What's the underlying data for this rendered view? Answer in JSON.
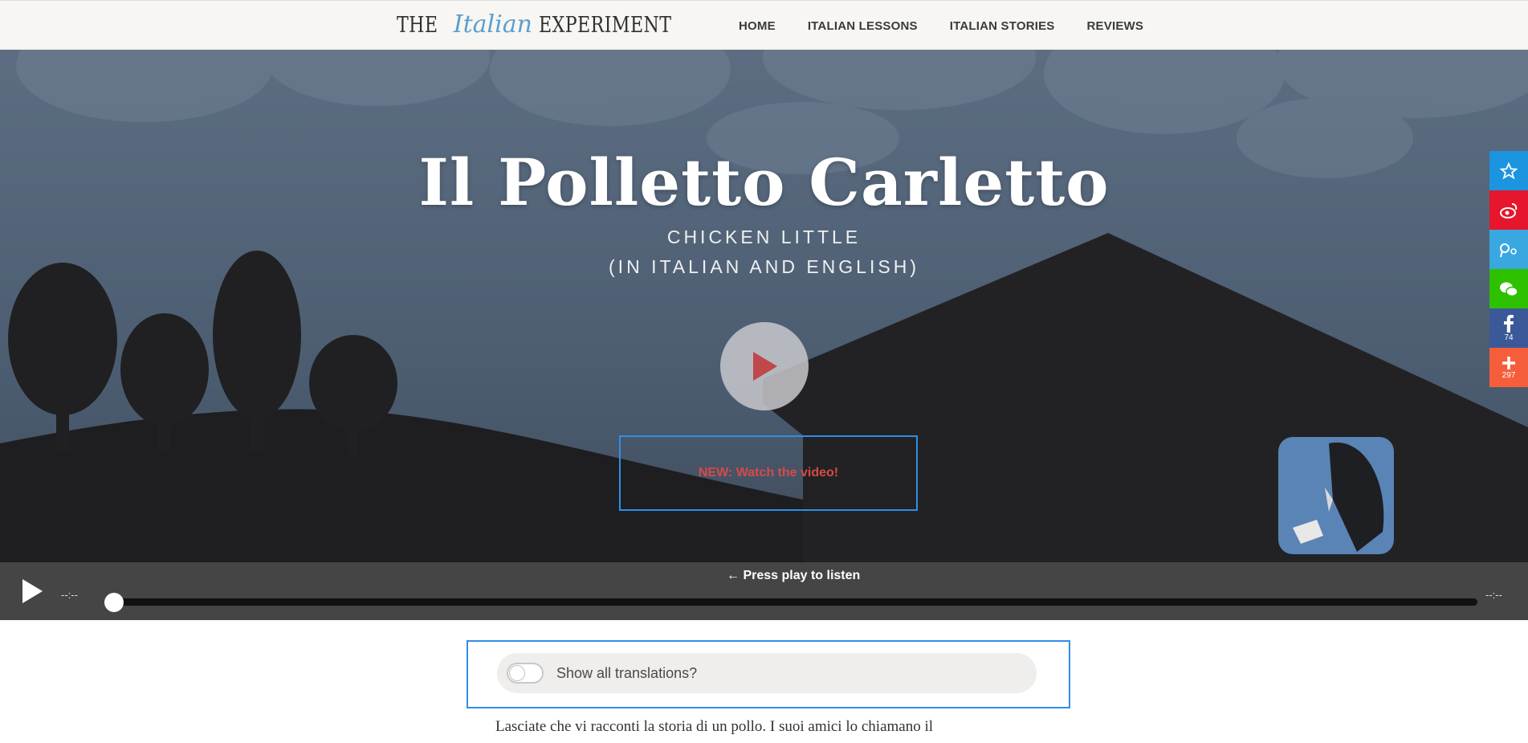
{
  "header": {
    "logo": {
      "the": "THE",
      "italian": "Italian",
      "experiment": "EXPERIMENT"
    },
    "nav": [
      "HOME",
      "ITALIAN LESSONS",
      "ITALIAN STORIES",
      "REVIEWS"
    ]
  },
  "hero": {
    "title": "Il Polletto Carletto",
    "subtitle_1": "CHICKEN LITTLE",
    "subtitle_2": "(IN ITALIAN AND ENGLISH)",
    "video_link": "NEW: Watch the video!"
  },
  "share": {
    "buttons": [
      {
        "icon": "star-icon",
        "color": "#1b95e0"
      },
      {
        "icon": "weibo-icon",
        "color": "#e6162d"
      },
      {
        "icon": "tencent-weibo-icon",
        "color": "#3aa8e0"
      },
      {
        "icon": "wechat-icon",
        "color": "#2dc100"
      },
      {
        "icon": "facebook-icon",
        "color": "#3b5998",
        "count": "74"
      },
      {
        "icon": "plus-icon",
        "color": "#f65e3b",
        "count": "297"
      }
    ]
  },
  "player": {
    "hint": "← Press play to listen",
    "elapsed": "--:--",
    "remaining": "--:--",
    "progress": 0
  },
  "translations": {
    "label": "Show all translations?",
    "enabled": false
  },
  "story": {
    "first_line": "Lasciate che vi racconti la storia di un pollo. I suoi amici lo chiamano il"
  },
  "colors": {
    "accent_border": "#2f8ee8",
    "video_text": "#d64a4a",
    "player_bg": "#454545"
  }
}
